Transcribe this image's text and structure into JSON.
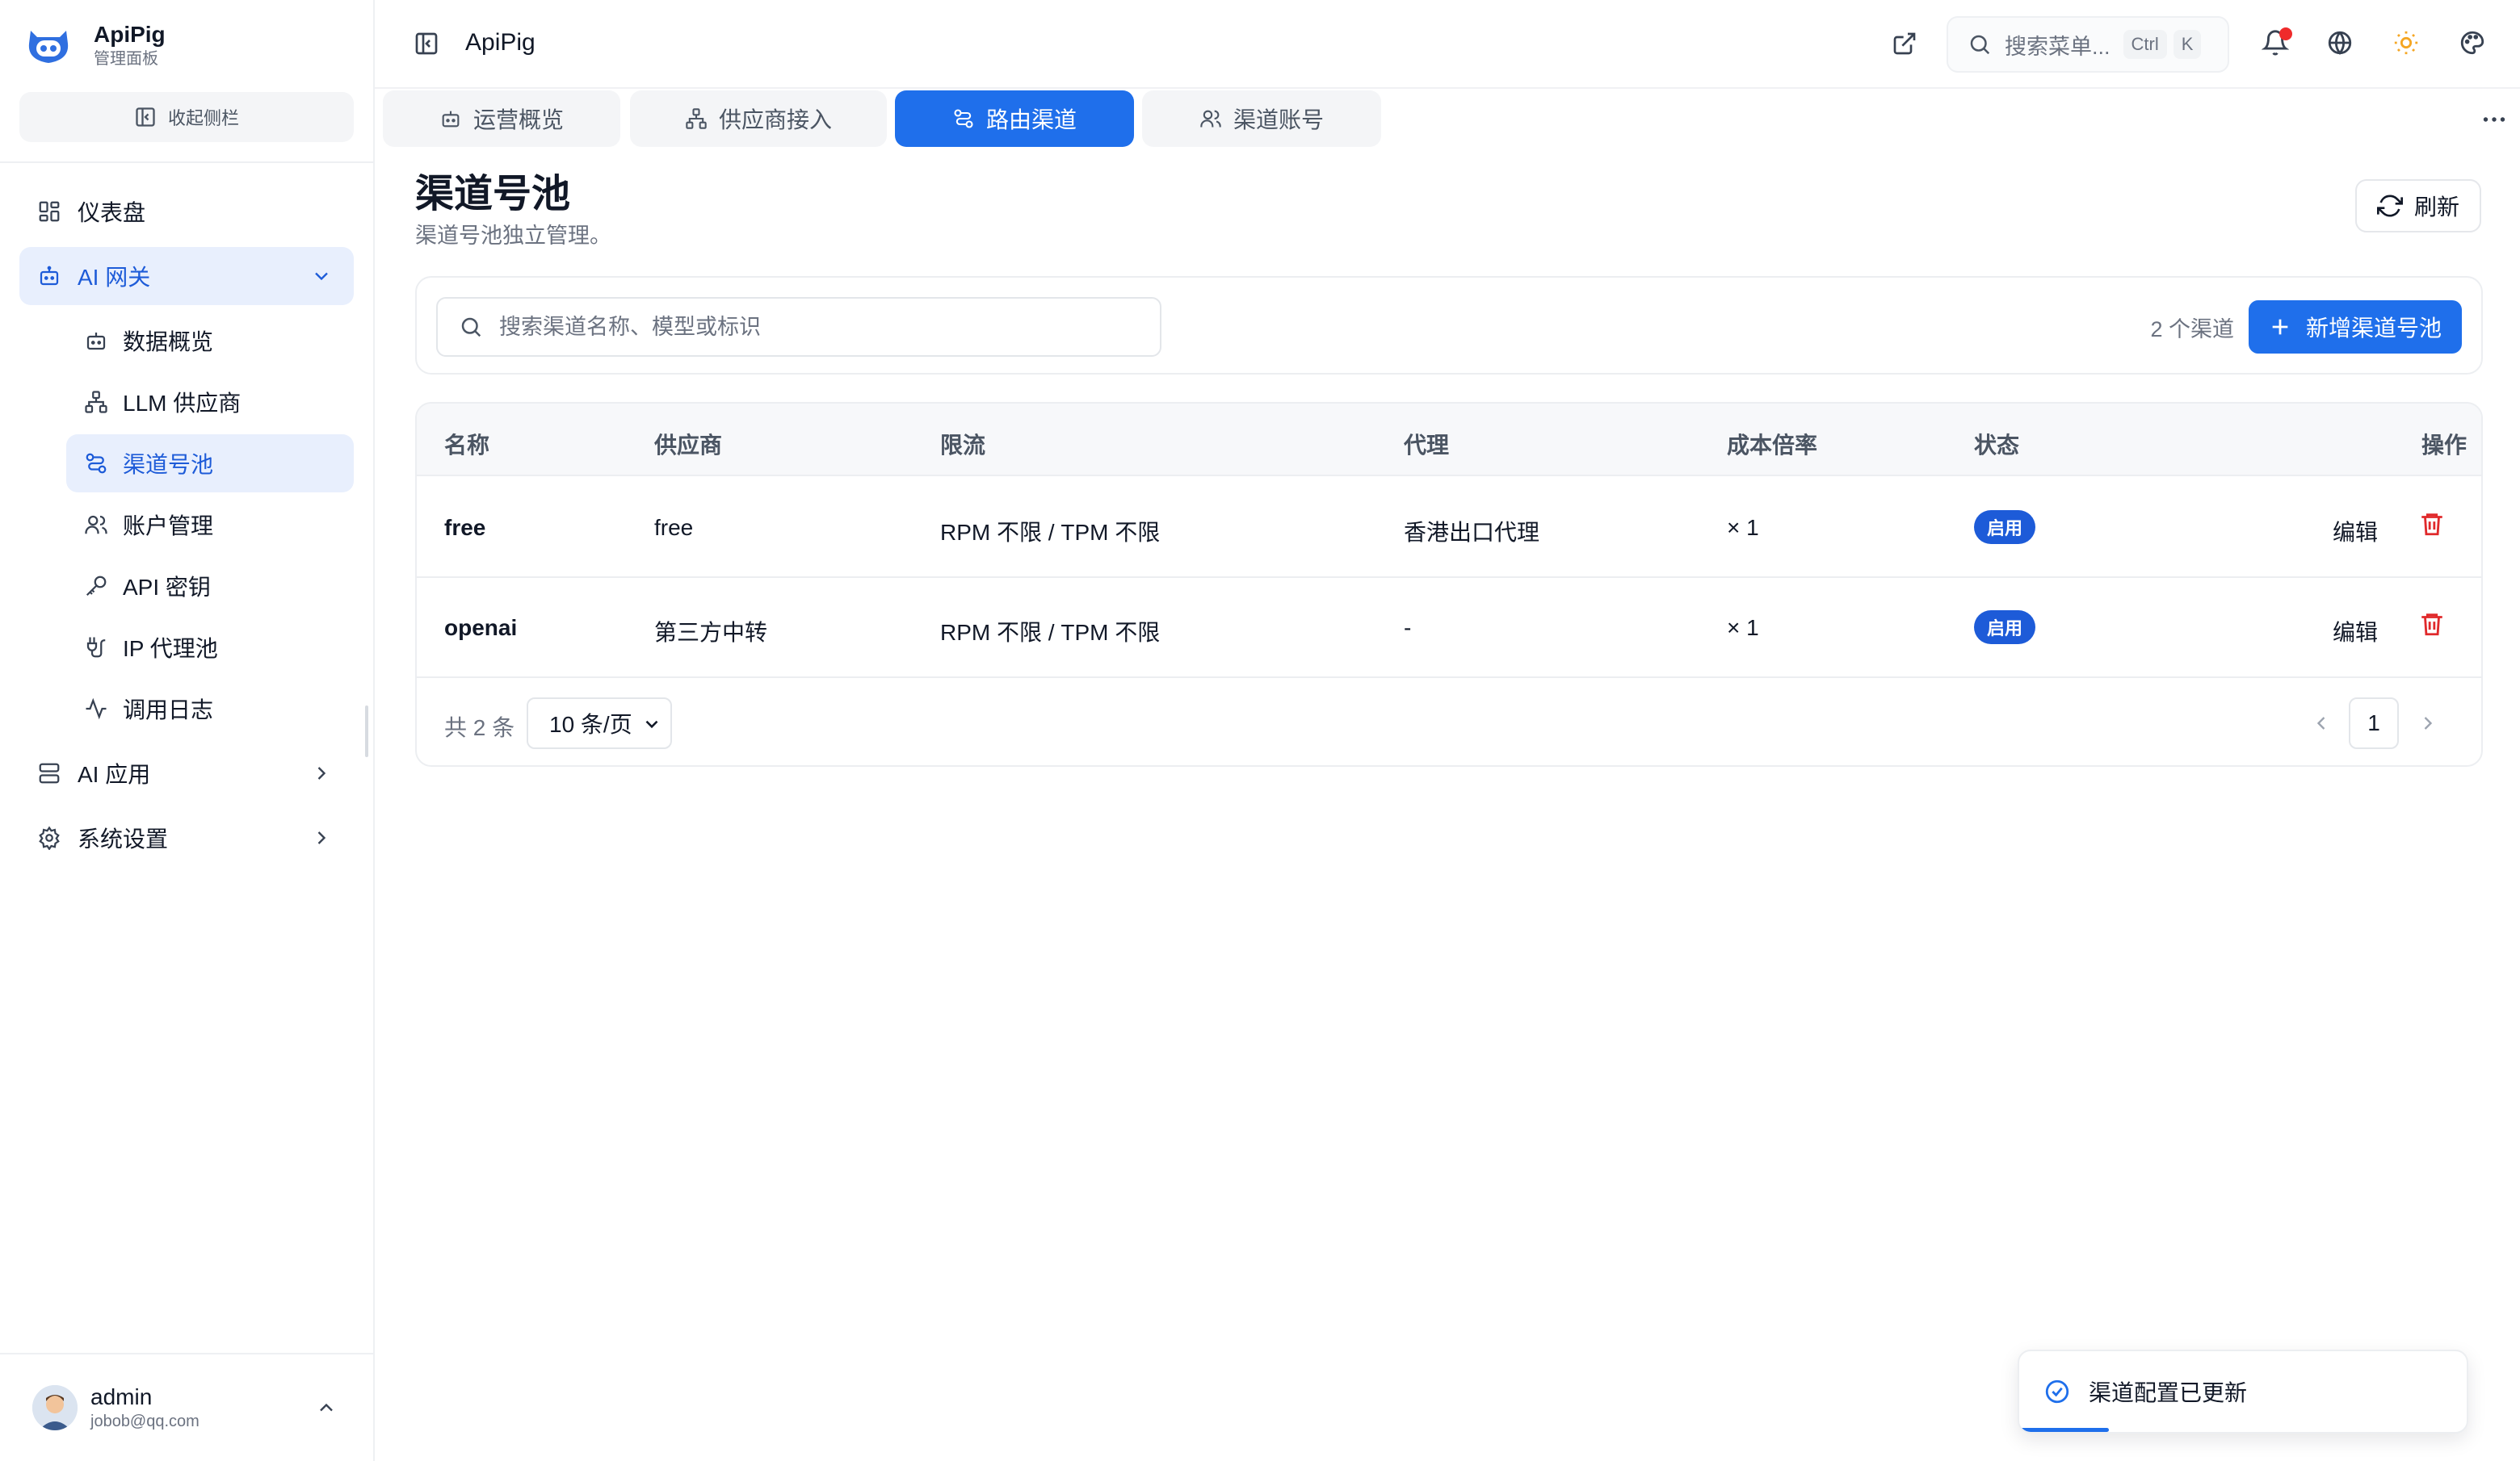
{
  "brand": {
    "name": "ApiPig",
    "subtitle": "管理面板"
  },
  "sidebar": {
    "collapse_label": "收起侧栏",
    "items": [
      {
        "label": "仪表盘",
        "icon": "dashboard-icon"
      },
      {
        "label": "AI 网关",
        "icon": "robot-icon",
        "expanded": true,
        "children": [
          {
            "label": "数据概览",
            "icon": "robot-icon"
          },
          {
            "label": "LLM 供应商",
            "icon": "network-icon"
          },
          {
            "label": "渠道号池",
            "icon": "route-icon",
            "active": true
          },
          {
            "label": "账户管理",
            "icon": "users-icon"
          },
          {
            "label": "API 密钥",
            "icon": "key-icon"
          },
          {
            "label": "IP 代理池",
            "icon": "plug-icon"
          },
          {
            "label": "调用日志",
            "icon": "activity-icon"
          }
        ]
      },
      {
        "label": "AI 应用",
        "icon": "server-icon"
      },
      {
        "label": "系统设置",
        "icon": "gear-icon"
      }
    ]
  },
  "user": {
    "name": "admin",
    "email": "jobob@qq.com"
  },
  "header": {
    "title": "ApiPig",
    "search_placeholder": "搜索菜单...",
    "shortcut_ctrl": "Ctrl",
    "shortcut_key": "K"
  },
  "tabs": [
    {
      "label": "运营概览",
      "icon": "robot-icon"
    },
    {
      "label": "供应商接入",
      "icon": "network-icon"
    },
    {
      "label": "路由渠道",
      "icon": "route-icon",
      "active": true
    },
    {
      "label": "渠道账号",
      "icon": "users-icon"
    }
  ],
  "page": {
    "title": "渠道号池",
    "subtitle": "渠道号池独立管理。",
    "refresh_label": "刷新",
    "search_placeholder": "搜索渠道名称、模型或标识",
    "count_text": "2 个渠道",
    "add_label": "新增渠道号池"
  },
  "table": {
    "columns": [
      "名称",
      "供应商",
      "限流",
      "代理",
      "成本倍率",
      "状态",
      "操作"
    ],
    "rows": [
      {
        "name": "free",
        "provider": "free",
        "rate_limit": "RPM 不限 / TPM 不限",
        "proxy": "香港出口代理",
        "cost": "× 1",
        "status": "启用",
        "edit": "编辑"
      },
      {
        "name": "openai",
        "provider": "第三方中转",
        "rate_limit": "RPM 不限 / TPM 不限",
        "proxy": "-",
        "cost": "× 1",
        "status": "启用",
        "edit": "编辑"
      }
    ],
    "total_text": "共 2 条",
    "page_size": "10 条/页",
    "current_page": "1"
  },
  "toast": {
    "message": "渠道配置已更新",
    "progress": 0.2
  },
  "colors": {
    "accent": "#1f6feb",
    "badge": "#1d5bd8",
    "danger": "#e0292b",
    "notif": "#ef2b2b"
  }
}
